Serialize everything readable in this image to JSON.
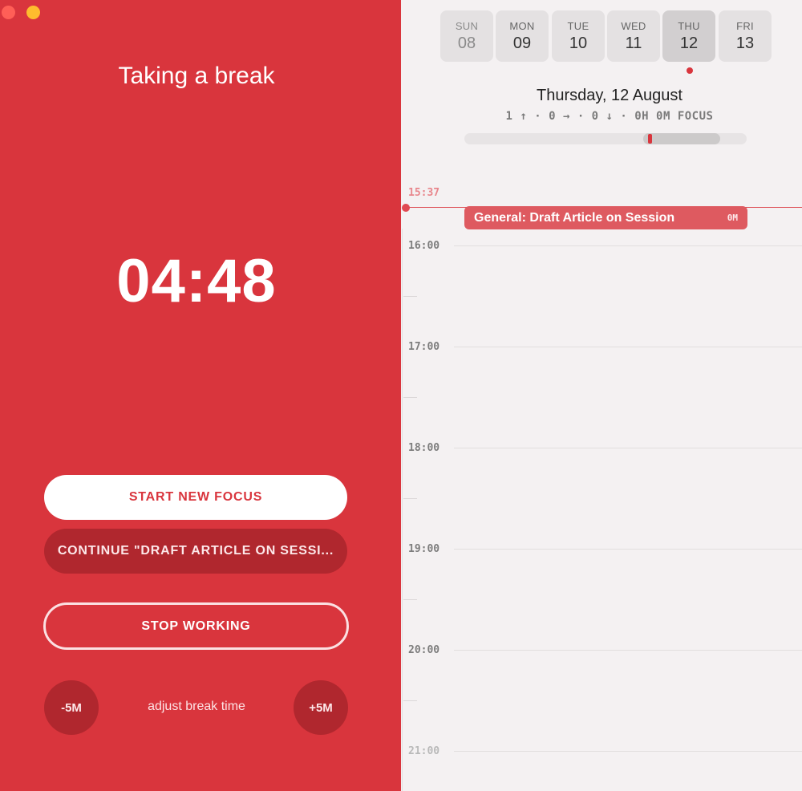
{
  "timer": {
    "title": "Taking a break",
    "time": "04:48"
  },
  "actions": {
    "start_new_focus": "START NEW FOCUS",
    "continue": "CONTINUE \"DRAFT ARTICLE ON SESSI...",
    "stop_working": "STOP WORKING",
    "minus": "-5M",
    "plus": "+5M",
    "adjust_label": "adjust break time"
  },
  "week": [
    {
      "name": "SUN",
      "num": "08"
    },
    {
      "name": "MON",
      "num": "09"
    },
    {
      "name": "TUE",
      "num": "10"
    },
    {
      "name": "WED",
      "num": "11"
    },
    {
      "name": "THU",
      "num": "12"
    },
    {
      "name": "FRI",
      "num": "13"
    }
  ],
  "selected_day_index": 4,
  "day": {
    "title": "Thursday, 12 August",
    "stats": "1 ↑ · 0 → · 0 ↓ · 0H 0M FOCUS"
  },
  "timeline": {
    "now": "15:37",
    "hours": [
      "16:00",
      "17:00",
      "18:00",
      "19:00",
      "20:00",
      "21:00"
    ],
    "event": {
      "title": "General: Draft Article on Session",
      "duration": "0M"
    }
  },
  "colors": {
    "accent": "#d9353d",
    "accent_dark": "#b0272e",
    "calendar_bg": "#f4f1f2"
  }
}
